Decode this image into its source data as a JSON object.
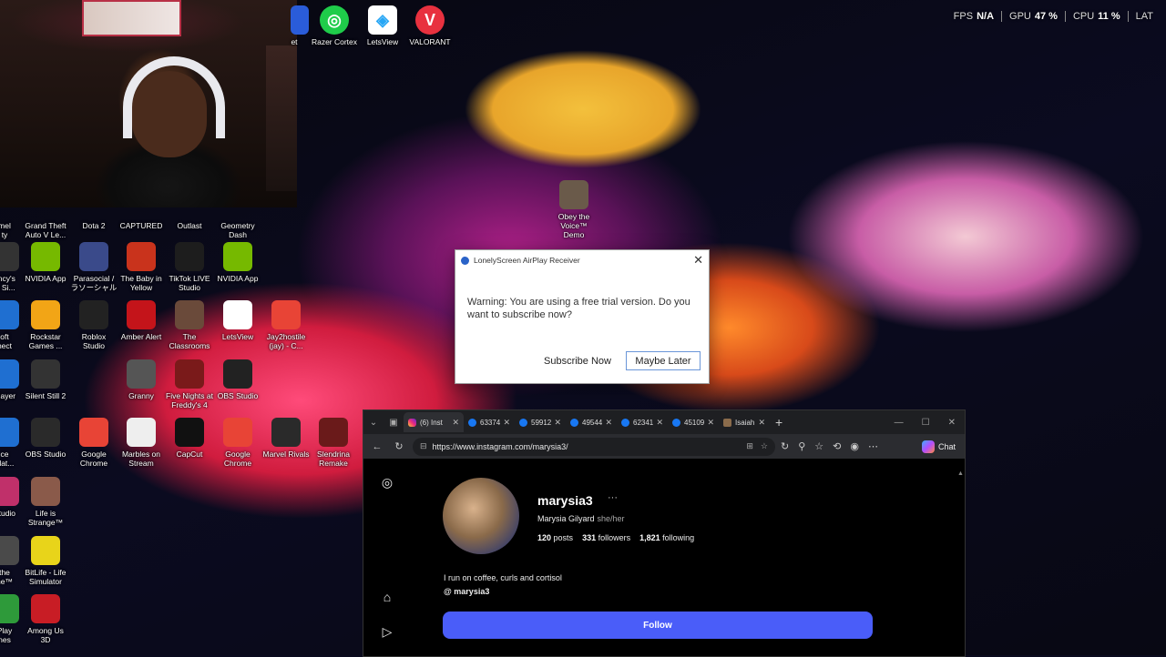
{
  "hud": {
    "fps_label": "FPS",
    "fps_value": "N/A",
    "gpu_label": "GPU",
    "gpu_value": "47 %",
    "cpu_label": "CPU",
    "cpu_value": "11 %",
    "lat_label": "LAT"
  },
  "desktop_icons_top": [
    {
      "label": "et",
      "icon": "partial-icon"
    },
    {
      "label": "Razer Cortex",
      "icon": "razer-cortex-icon"
    },
    {
      "label": "LetsView",
      "icon": "letsview-icon"
    },
    {
      "label": "VALORANT",
      "icon": "valorant-icon"
    }
  ],
  "desktop_icons": [
    {
      "label": "mel\nty"
    },
    {
      "label": "Grand Theft\nAuto V Le..."
    },
    {
      "label": "Dota 2"
    },
    {
      "label": "CAPTURED"
    },
    {
      "label": "Outlast"
    },
    {
      "label": "Geometry\nDash"
    },
    {
      "label": "ancy's\nw Si..."
    },
    {
      "label": "NVIDIA App"
    },
    {
      "label": "Parasocial /\nラソーシャル"
    },
    {
      "label": "The Baby in\nYellow"
    },
    {
      "label": "TikTok LIVE\nStudio"
    },
    {
      "label": "NVIDIA App"
    },
    {
      "label": "oft\nnect"
    },
    {
      "label": "Rockstar\nGames ..."
    },
    {
      "label": "Roblox\nStudio"
    },
    {
      "label": "Amber Alert"
    },
    {
      "label": "The\nClassrooms"
    },
    {
      "label": "LetsView"
    },
    {
      "label": "Jay2hostile\n(jay) - C..."
    },
    {
      "label": "Player"
    },
    {
      "label": "Silent Still 2"
    },
    {
      "label": "Granny"
    },
    {
      "label": "Five Nights at\nFreddy's 4"
    },
    {
      "label": "OBS Studio"
    },
    {
      "label": "ce\nulat..."
    },
    {
      "label": "OBS Studio"
    },
    {
      "label": "Google\nChrome"
    },
    {
      "label": "Marbles on\nStream"
    },
    {
      "label": "CapCut"
    },
    {
      "label": "Google\nChrome"
    },
    {
      "label": "Marvel Rivals"
    },
    {
      "label": "Slendrina\nRemake"
    },
    {
      "label": "Studio"
    },
    {
      "label": "Life is\nStrange™"
    },
    {
      "label": "the\nne™"
    },
    {
      "label": "BitLife - Life\nSimulator"
    },
    {
      "label": "Play\nnes"
    },
    {
      "label": "Among Us\n3D"
    },
    {
      "label": "Obey the\nVoice™ Demo"
    }
  ],
  "dialog": {
    "title": "LonelyScreen AirPlay Receiver",
    "message": "Warning: You are using a free trial version. Do you want to subscribe now?",
    "subscribe_label": "Subscribe Now",
    "later_label": "Maybe Later"
  },
  "browser": {
    "tabs": [
      {
        "title": "(6) Inst",
        "icon": "instagram-icon",
        "active": true
      },
      {
        "title": "63374",
        "icon": "facebook-icon"
      },
      {
        "title": "59912",
        "icon": "facebook-icon"
      },
      {
        "title": "49544",
        "icon": "facebook-icon"
      },
      {
        "title": "62341",
        "icon": "facebook-icon"
      },
      {
        "title": "45109",
        "icon": "facebook-icon"
      },
      {
        "title": "Isaiah",
        "icon": "picture-icon"
      }
    ],
    "url": "https://www.instagram.com/marysia3/",
    "chat_label": "Chat"
  },
  "profile": {
    "username": "marysia3",
    "full_name": "Marysia Gilyard",
    "pronouns": "she/her",
    "posts_count": "120",
    "posts_label": "posts",
    "followers_count": "331",
    "followers_label": "followers",
    "following_count": "1,821",
    "following_label": "following",
    "bio": "I run on coffee, curls and cortisol",
    "threads_handle": "marysia3",
    "follow_label": "Follow"
  },
  "colors": {
    "follow_button": "#4a5df9",
    "browser_chrome": "#2b2c30",
    "dialog_bg": "#ffffff"
  }
}
